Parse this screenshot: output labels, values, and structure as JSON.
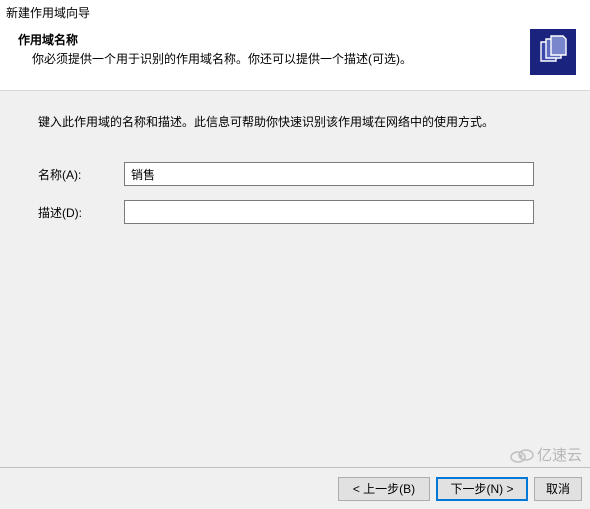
{
  "window": {
    "title": "新建作用域向导"
  },
  "header": {
    "title": "作用域名称",
    "subtitle": "你必须提供一个用于识别的作用域名称。你还可以提供一个描述(可选)。"
  },
  "content": {
    "instruction": "键入此作用域的名称和描述。此信息可帮助你快速识别该作用域在网络中的使用方式。",
    "name_label": "名称(A):",
    "name_value": "销售",
    "desc_label": "描述(D):",
    "desc_value": ""
  },
  "footer": {
    "back": "< 上一步(B)",
    "next": "下一步(N) >",
    "cancel": "取消"
  },
  "watermark": {
    "text": "亿速云"
  }
}
